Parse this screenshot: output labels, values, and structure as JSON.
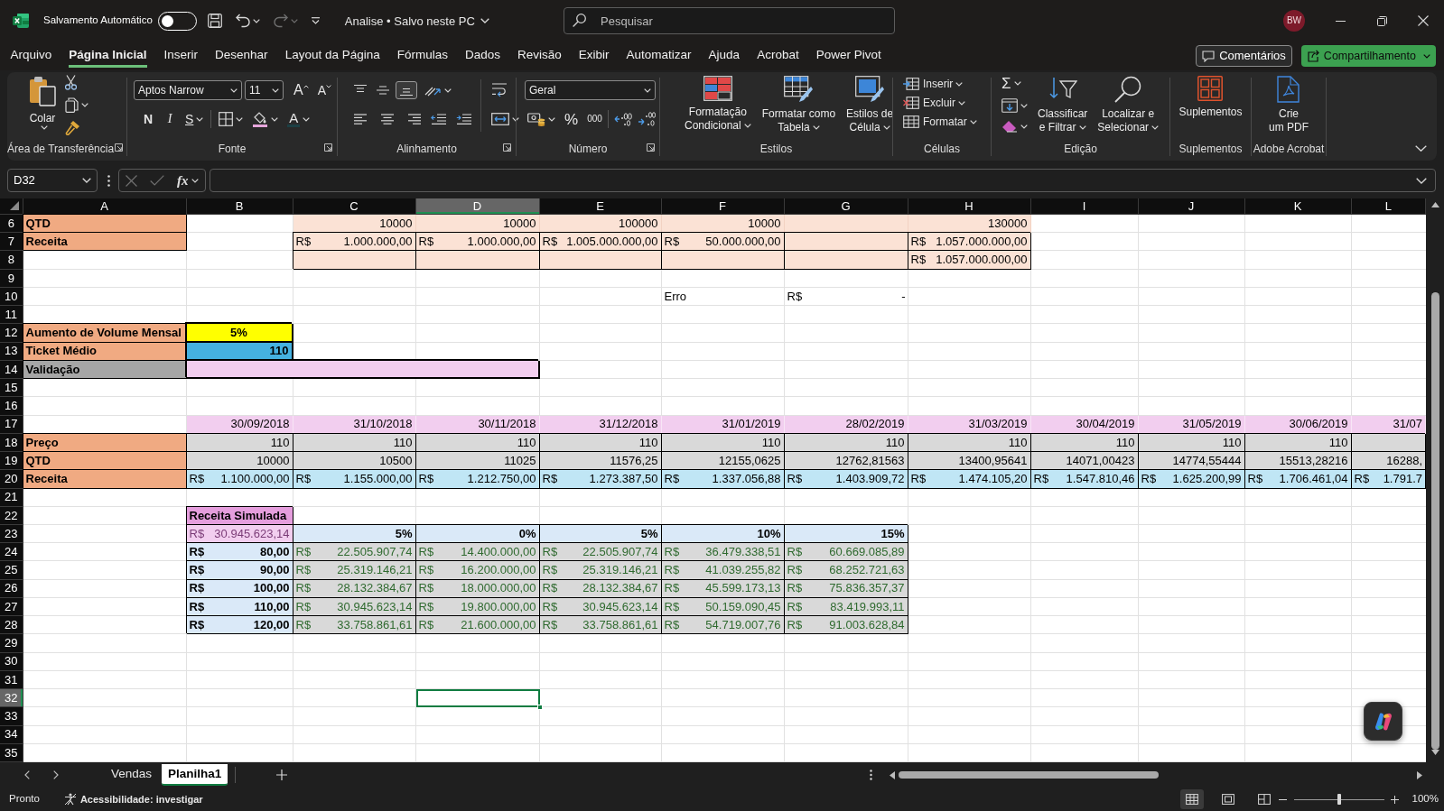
{
  "title_bar": {
    "autosave": {
      "label": "Salvamento Automático",
      "on": false
    },
    "quick_access": [
      {
        "disabled": false
      },
      {
        "disabled": false
      },
      {
        "disabled": true
      }
    ],
    "document": "Analise • Salvo neste PC",
    "search": {
      "placeholder": "Pesquisar"
    },
    "avatar": "BW"
  },
  "menu_tabs": [
    {
      "label": "Arquivo",
      "selected": false
    },
    {
      "label": "Página Inicial",
      "selected": true
    },
    {
      "label": "Inserir",
      "selected": false
    },
    {
      "label": "Desenhar",
      "selected": false
    },
    {
      "label": "Layout da Página",
      "selected": false
    },
    {
      "label": "Fórmulas",
      "selected": false
    },
    {
      "label": "Dados",
      "selected": false
    },
    {
      "label": "Revisão",
      "selected": false
    },
    {
      "label": "Exibir",
      "selected": false
    },
    {
      "label": "Automatizar",
      "selected": false
    },
    {
      "label": "Ajuda",
      "selected": false
    },
    {
      "label": "Acrobat",
      "selected": false
    },
    {
      "label": "Power Pivot",
      "selected": false
    }
  ],
  "header_buttons": [
    {
      "kind": "comments",
      "label": "Comentários"
    },
    {
      "kind": "share",
      "label": "Compartilhamento"
    }
  ],
  "ribbon": {
    "groups": [
      {
        "kind": "clipboard",
        "label": "Área de Transferência",
        "launcher": true,
        "buttons": [
          "Colar"
        ]
      },
      {
        "kind": "font",
        "label": "Fonte",
        "launcher": true,
        "font_name": "Aptos Narrow",
        "font_size": "11",
        "buttons": [
          "A",
          "A",
          "N",
          "I",
          "S",
          "A"
        ]
      },
      {
        "kind": "alignment",
        "label": "Alinhamento",
        "launcher": true,
        "vertical_align": [
          {
            "selected": false
          },
          {
            "selected": false
          },
          {
            "selected": true
          }
        ]
      },
      {
        "kind": "number",
        "label": "Número",
        "launcher": true,
        "format": "Geral",
        "buttons": [
          "%",
          "000"
        ]
      },
      {
        "kind": "styles",
        "label": "Estilos",
        "launcher": false,
        "buttons": [
          {
            "lines": [
              "Formatação",
              "Condicional"
            ],
            "dropdown": true
          },
          {
            "lines": [
              "Formatar como",
              "Tabela"
            ],
            "dropdown": true
          },
          {
            "lines": [
              "Estilos de",
              "Célula"
            ],
            "dropdown": true
          }
        ]
      },
      {
        "kind": "cells",
        "label": "Células",
        "launcher": false,
        "buttons": [
          "Inserir",
          "Excluir",
          "Formatar"
        ]
      },
      {
        "kind": "editing",
        "label": "Edição",
        "launcher": false,
        "buttons": [
          "Σ"
        ],
        "large_buttons": [
          {
            "lines": [
              "Classificar",
              "e Filtrar"
            ],
            "dropdown": true
          },
          {
            "lines": [
              "Localizar e",
              "Selecionar"
            ],
            "dropdown": true
          }
        ]
      },
      {
        "kind": "addins",
        "label": "Suplementos",
        "launcher": false,
        "buttons": [
          {
            "lines": [
              "Suplementos"
            ],
            "dropdown": false
          }
        ]
      },
      {
        "kind": "acrobat",
        "label": "Adobe Acrobat",
        "launcher": false,
        "buttons": [
          {
            "lines": [
              "Crie",
              "um PDF"
            ],
            "dropdown": false
          }
        ]
      }
    ]
  },
  "formula_bar": {
    "name_box": "D32",
    "edit_buttons": [
      {
        "disabled": true
      },
      {
        "disabled": true
      }
    ],
    "function_label": "fx"
  },
  "sheet": {
    "columns": [
      {
        "label": "A",
        "selected": false
      },
      {
        "label": "B",
        "selected": false
      },
      {
        "label": "C",
        "selected": false
      },
      {
        "label": "D",
        "selected": true
      },
      {
        "label": "E",
        "selected": false
      },
      {
        "label": "F",
        "selected": false
      },
      {
        "label": "G",
        "selected": false
      },
      {
        "label": "H",
        "selected": false
      },
      {
        "label": "I",
        "selected": false
      },
      {
        "label": "J",
        "selected": false
      },
      {
        "label": "K",
        "selected": false
      },
      {
        "label": "L",
        "selected": false
      }
    ],
    "rows": [
      {
        "number": "6",
        "selected": false,
        "cells": [
          {
            "kind": "label",
            "text": "QTD"
          },
          {
            "kind": "plain"
          },
          {
            "kind": "peach",
            "text": "10000"
          },
          {
            "kind": "peach",
            "text": "10000"
          },
          {
            "kind": "peach",
            "text": "100000"
          },
          {
            "kind": "peach",
            "text": "10000"
          },
          {
            "kind": "peach"
          },
          {
            "kind": "peach",
            "text": "130000"
          }
        ]
      },
      {
        "number": "7",
        "selected": false,
        "cells": [
          {
            "kind": "label",
            "text": "Receita"
          },
          {
            "kind": "plain"
          },
          {
            "kind": "peachbox",
            "symbol": "R$",
            "amount": "1.000.000,00"
          },
          {
            "kind": "peachbox",
            "symbol": "R$",
            "amount": "1.000.000,00"
          },
          {
            "kind": "peachbox",
            "symbol": "R$",
            "amount": "1.005.000.000,00"
          },
          {
            "kind": "peachbox",
            "symbol": "R$",
            "amount": "50.000.000,00"
          },
          {
            "kind": "peachbox"
          },
          {
            "kind": "peachbox",
            "symbol": "R$",
            "amount": "1.057.000.000,00"
          }
        ]
      },
      {
        "number": "8",
        "selected": false,
        "cells": [
          {
            "kind": "plain"
          },
          {
            "kind": "plain"
          },
          {
            "kind": "peachbox"
          },
          {
            "kind": "peachbox"
          },
          {
            "kind": "peachbox"
          },
          {
            "kind": "peachbox"
          },
          {
            "kind": "peachbox"
          },
          {
            "kind": "peachbox",
            "symbol": "R$",
            "amount": "1.057.000.000,00"
          }
        ]
      },
      {
        "number": "9",
        "selected": false
      },
      {
        "number": "10",
        "selected": false,
        "cells": [
          {
            "kind": "plain"
          },
          {
            "kind": "plain"
          },
          {
            "kind": "plain"
          },
          {
            "kind": "plain"
          },
          {
            "kind": "plain"
          },
          {
            "kind": "note",
            "text": "Erro"
          },
          {
            "kind": "plain",
            "symbol": "R$",
            "amount": "-"
          }
        ]
      },
      {
        "number": "11",
        "selected": false
      },
      {
        "number": "12",
        "selected": false,
        "cells": [
          {
            "kind": "label",
            "text": "Aumento de Volume Mensal"
          },
          {
            "kind": "yellow",
            "text": "5%"
          }
        ]
      },
      {
        "number": "13",
        "selected": false,
        "cells": [
          {
            "kind": "label",
            "text": "Ticket Médio"
          },
          {
            "kind": "blue",
            "text": "110"
          }
        ]
      },
      {
        "number": "14",
        "selected": false,
        "cells": [
          {
            "kind": "greylabel",
            "text": "Validação"
          },
          {
            "kind": "validation"
          },
          {
            "kind": "validation"
          },
          {
            "kind": "validation"
          }
        ]
      },
      {
        "number": "15",
        "selected": false
      },
      {
        "number": "16",
        "selected": false
      },
      {
        "number": "17",
        "selected": false,
        "cells": [
          {
            "kind": "plain"
          },
          {
            "kind": "date",
            "text": "30/09/2018"
          },
          {
            "kind": "date",
            "text": "31/10/2018"
          },
          {
            "kind": "date",
            "text": "30/11/2018"
          },
          {
            "kind": "date",
            "text": "31/12/2018"
          },
          {
            "kind": "date",
            "text": "31/01/2019"
          },
          {
            "kind": "date",
            "text": "28/02/2019"
          },
          {
            "kind": "date",
            "text": "31/03/2019"
          },
          {
            "kind": "date",
            "text": "30/04/2019"
          },
          {
            "kind": "date",
            "text": "31/05/2019"
          },
          {
            "kind": "date",
            "text": "30/06/2019"
          },
          {
            "kind": "date",
            "text": "31/07"
          }
        ]
      },
      {
        "number": "18",
        "selected": false,
        "cells": [
          {
            "kind": "label",
            "text": "Preço"
          },
          {
            "kind": "grey",
            "text": "110"
          },
          {
            "kind": "grey",
            "text": "110"
          },
          {
            "kind": "grey",
            "text": "110"
          },
          {
            "kind": "grey",
            "text": "110"
          },
          {
            "kind": "grey",
            "text": "110"
          },
          {
            "kind": "grey",
            "text": "110"
          },
          {
            "kind": "grey",
            "text": "110"
          },
          {
            "kind": "grey",
            "text": "110"
          },
          {
            "kind": "grey",
            "text": "110"
          },
          {
            "kind": "grey",
            "text": "110"
          },
          {
            "kind": "grey"
          }
        ]
      },
      {
        "number": "19",
        "selected": false,
        "cells": [
          {
            "kind": "label",
            "text": "QTD"
          },
          {
            "kind": "grey",
            "text": "10000"
          },
          {
            "kind": "grey",
            "text": "10500"
          },
          {
            "kind": "grey",
            "text": "11025"
          },
          {
            "kind": "grey",
            "text": "11576,25"
          },
          {
            "kind": "grey",
            "text": "12155,0625"
          },
          {
            "kind": "grey",
            "text": "12762,81563"
          },
          {
            "kind": "grey",
            "text": "13400,95641"
          },
          {
            "kind": "grey",
            "text": "14071,00423"
          },
          {
            "kind": "grey",
            "text": "14774,55444"
          },
          {
            "kind": "grey",
            "text": "15513,28216"
          },
          {
            "kind": "grey",
            "text": "16288,"
          }
        ]
      },
      {
        "number": "20",
        "selected": false,
        "cells": [
          {
            "kind": "label",
            "text": "Receita"
          },
          {
            "kind": "revenue",
            "symbol": "R$",
            "amount": "1.100.000,00"
          },
          {
            "kind": "revenue",
            "symbol": "R$",
            "amount": "1.155.000,00"
          },
          {
            "kind": "revenue",
            "symbol": "R$",
            "amount": "1.212.750,00"
          },
          {
            "kind": "revenue",
            "symbol": "R$",
            "amount": "1.273.387,50"
          },
          {
            "kind": "revenue",
            "symbol": "R$",
            "amount": "1.337.056,88"
          },
          {
            "kind": "revenue",
            "symbol": "R$",
            "amount": "1.403.909,72"
          },
          {
            "kind": "revenue",
            "symbol": "R$",
            "amount": "1.474.105,20"
          },
          {
            "kind": "revenue",
            "symbol": "R$",
            "amount": "1.547.810,46"
          },
          {
            "kind": "revenue",
            "symbol": "R$",
            "amount": "1.625.200,99"
          },
          {
            "kind": "revenue",
            "symbol": "R$",
            "amount": "1.706.461,04"
          },
          {
            "kind": "revenue",
            "symbol": "R$",
            "amount": "1.791.7"
          }
        ]
      },
      {
        "number": "21",
        "selected": false
      },
      {
        "number": "22",
        "selected": false,
        "cells": [
          {
            "kind": "plain"
          },
          {
            "kind": "orchid",
            "text": "Receita Simulada"
          }
        ]
      },
      {
        "number": "23",
        "selected": false,
        "cells": [
          {
            "kind": "plain"
          },
          {
            "kind": "total",
            "symbol": "R$",
            "amount": "30.945.623,14"
          },
          {
            "kind": "header",
            "text": "5%"
          },
          {
            "kind": "header",
            "text": "0%"
          },
          {
            "kind": "header",
            "text": "5%"
          },
          {
            "kind": "header",
            "text": "10%"
          },
          {
            "kind": "header",
            "text": "15%"
          }
        ]
      },
      {
        "number": "24",
        "selected": false,
        "cells": [
          {
            "kind": "plain"
          },
          {
            "kind": "header",
            "symbol": "R$",
            "amount": "80,00"
          },
          {
            "kind": "data",
            "symbol": "R$",
            "amount": "22.505.907,74"
          },
          {
            "kind": "data",
            "symbol": "R$",
            "amount": "14.400.000,00"
          },
          {
            "kind": "data",
            "symbol": "R$",
            "amount": "22.505.907,74"
          },
          {
            "kind": "data",
            "symbol": "R$",
            "amount": "36.479.338,51"
          },
          {
            "kind": "data",
            "symbol": "R$",
            "amount": "60.669.085,89"
          }
        ]
      },
      {
        "number": "25",
        "selected": false,
        "cells": [
          {
            "kind": "plain"
          },
          {
            "kind": "header",
            "symbol": "R$",
            "amount": "90,00"
          },
          {
            "kind": "data",
            "symbol": "R$",
            "amount": "25.319.146,21"
          },
          {
            "kind": "data",
            "symbol": "R$",
            "amount": "16.200.000,00"
          },
          {
            "kind": "data",
            "symbol": "R$",
            "amount": "25.319.146,21"
          },
          {
            "kind": "data",
            "symbol": "R$",
            "amount": "41.039.255,82"
          },
          {
            "kind": "data",
            "symbol": "R$",
            "amount": "68.252.721,63"
          }
        ]
      },
      {
        "number": "26",
        "selected": false,
        "cells": [
          {
            "kind": "plain"
          },
          {
            "kind": "header",
            "symbol": "R$",
            "amount": "100,00"
          },
          {
            "kind": "data",
            "symbol": "R$",
            "amount": "28.132.384,67"
          },
          {
            "kind": "data",
            "symbol": "R$",
            "amount": "18.000.000,00"
          },
          {
            "kind": "data",
            "symbol": "R$",
            "amount": "28.132.384,67"
          },
          {
            "kind": "data",
            "symbol": "R$",
            "amount": "45.599.173,13"
          },
          {
            "kind": "data",
            "symbol": "R$",
            "amount": "75.836.357,37"
          }
        ]
      },
      {
        "number": "27",
        "selected": false,
        "cells": [
          {
            "kind": "plain"
          },
          {
            "kind": "header",
            "symbol": "R$",
            "amount": "110,00"
          },
          {
            "kind": "data",
            "symbol": "R$",
            "amount": "30.945.623,14"
          },
          {
            "kind": "data",
            "symbol": "R$",
            "amount": "19.800.000,00"
          },
          {
            "kind": "data",
            "symbol": "R$",
            "amount": "30.945.623,14"
          },
          {
            "kind": "data",
            "symbol": "R$",
            "amount": "50.159.090,45"
          },
          {
            "kind": "data",
            "symbol": "R$",
            "amount": "83.419.993,11"
          }
        ]
      },
      {
        "number": "28",
        "selected": false,
        "cells": [
          {
            "kind": "plain"
          },
          {
            "kind": "header",
            "symbol": "R$",
            "amount": "120,00"
          },
          {
            "kind": "data",
            "symbol": "R$",
            "amount": "33.758.861,61"
          },
          {
            "kind": "data",
            "symbol": "R$",
            "amount": "21.600.000,00"
          },
          {
            "kind": "data",
            "symbol": "R$",
            "amount": "33.758.861,61"
          },
          {
            "kind": "data",
            "symbol": "R$",
            "amount": "54.719.007,76"
          },
          {
            "kind": "data",
            "symbol": "R$",
            "amount": "91.003.628,84"
          }
        ]
      },
      {
        "number": "29",
        "selected": false
      },
      {
        "number": "30",
        "selected": false
      },
      {
        "number": "31",
        "selected": false
      },
      {
        "number": "32",
        "selected": true
      },
      {
        "number": "33",
        "selected": false
      },
      {
        "number": "34",
        "selected": false
      },
      {
        "number": "35",
        "selected": false
      }
    ]
  },
  "sheet_tabs": [
    {
      "label": "Vendas",
      "selected": false
    },
    {
      "label": "Planilha1",
      "selected": true
    }
  ],
  "status_bar": {
    "status": "Pronto",
    "accessibility": "Acessibilidade: investigar",
    "views": [
      {
        "selected": true
      },
      {
        "selected": false
      },
      {
        "selected": false
      }
    ],
    "zoom": {
      "level": 0.5,
      "reading": "100%"
    }
  }
}
